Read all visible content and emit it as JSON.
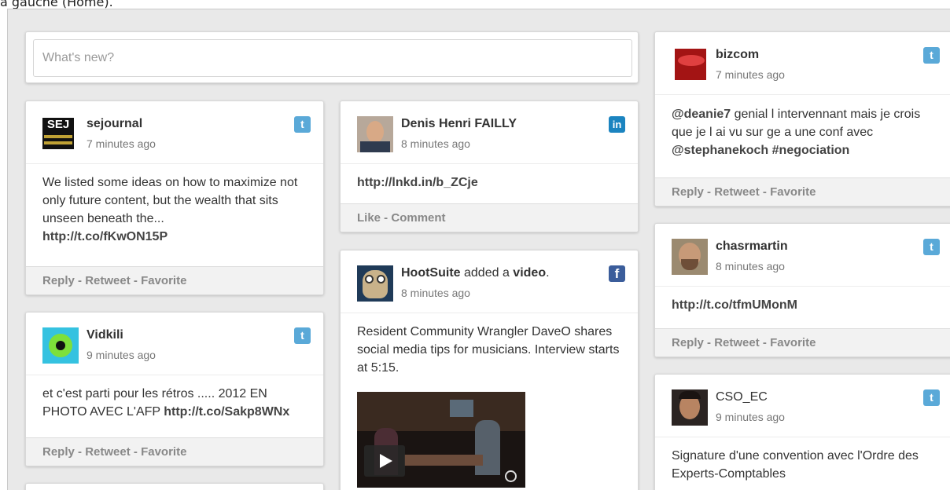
{
  "caption": "à gauche (Home).",
  "composer": {
    "placeholder": "What's new?"
  },
  "actions": {
    "reply": "Reply",
    "retweet": "Retweet",
    "favorite": "Favorite",
    "like": "Like",
    "comment": "Comment",
    "sep": " - "
  },
  "networks": {
    "twitter": "twitter-icon",
    "linkedin": "linkedin-icon",
    "facebook": "facebook-icon"
  },
  "colors": {
    "twitter": "#5aa9d8",
    "linkedin": "#1b84c0",
    "facebook": "#3b5d9b"
  },
  "posts": {
    "sejournal": {
      "user": "sejournal",
      "time": "7 minutes ago",
      "avatar_text": "SEJ",
      "text": "We listed some ideas on how to maximize not only future content, but the wealth that sits unseen beneath the...",
      "link": "http://t.co/fKwON15P"
    },
    "vidkili": {
      "user": "Vidkili",
      "time": "9 minutes ago",
      "text": "et c'est parti pour les rétros ..... 2012 EN PHOTO AVEC L'AFP",
      "link": "http://t.co/Sakp8WNx"
    },
    "denis": {
      "user": "Denis Henri FAILLY",
      "time": "8 minutes ago",
      "link": "http://lnkd.in/b_ZCje"
    },
    "hootsuite": {
      "user": "HootSuite",
      "added": "added a",
      "video_word": "video",
      "period": ".",
      "time": "8 minutes ago",
      "text": "Resident Community Wrangler DaveO shares social media tips for musicians. Interview starts at 5:15."
    },
    "bizcom": {
      "user": "bizcom",
      "time": "7 minutes ago",
      "mention1": "@deanie7",
      "text1": " genial l intervennant mais je crois que je l ai vu sur ge a une conf avec ",
      "mention2": "@stephanekoch",
      "hashtag": "#negociation"
    },
    "chasrmartin": {
      "user": "chasrmartin",
      "time": "8 minutes ago",
      "link": "http://t.co/tfmUMonM"
    },
    "cso": {
      "user": "CSO_EC",
      "time": "9 minutes ago",
      "text": "Signature d'une convention avec l'Ordre des Experts-Comptables"
    }
  }
}
